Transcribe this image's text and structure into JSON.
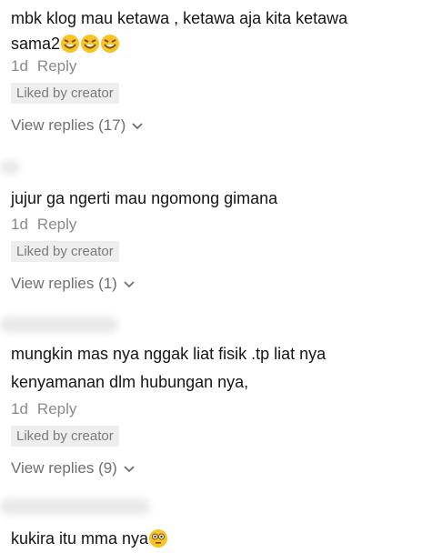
{
  "comments": [
    {
      "text_line1": "mbk klog mau ketawa , ketawa aja kita ketawa",
      "text_line2": "sama2",
      "emoji_names": [
        "rolling-laughing-emoji",
        "rolling-laughing-emoji",
        "rolling-laughing-emoji"
      ],
      "time": "1d",
      "reply": "Reply",
      "badge": "Liked by creator",
      "view_replies": "View replies (17)"
    },
    {
      "text_line1": "jujur ga ngerti mau ngomong gimana",
      "time": "1d",
      "reply": "Reply",
      "badge": "Liked by creator",
      "view_replies": "View replies (1)"
    },
    {
      "text_line1": "mungkin mas nya nggak liat fisik .tp liat nya",
      "text_line2": "kenyamanan dlm hubungan nya,",
      "time": "1d",
      "reply": "Reply",
      "badge": "Liked by creator",
      "view_replies": "View replies (9)"
    },
    {
      "text_line1": "kukira itu mma nya",
      "emoji_names": [
        "flushed-face-emoji"
      ]
    }
  ],
  "colors": {
    "text": "#161616",
    "meta": "#8a8a8a",
    "badge_bg": "#eeeeee",
    "emoji": "#f7c325"
  }
}
